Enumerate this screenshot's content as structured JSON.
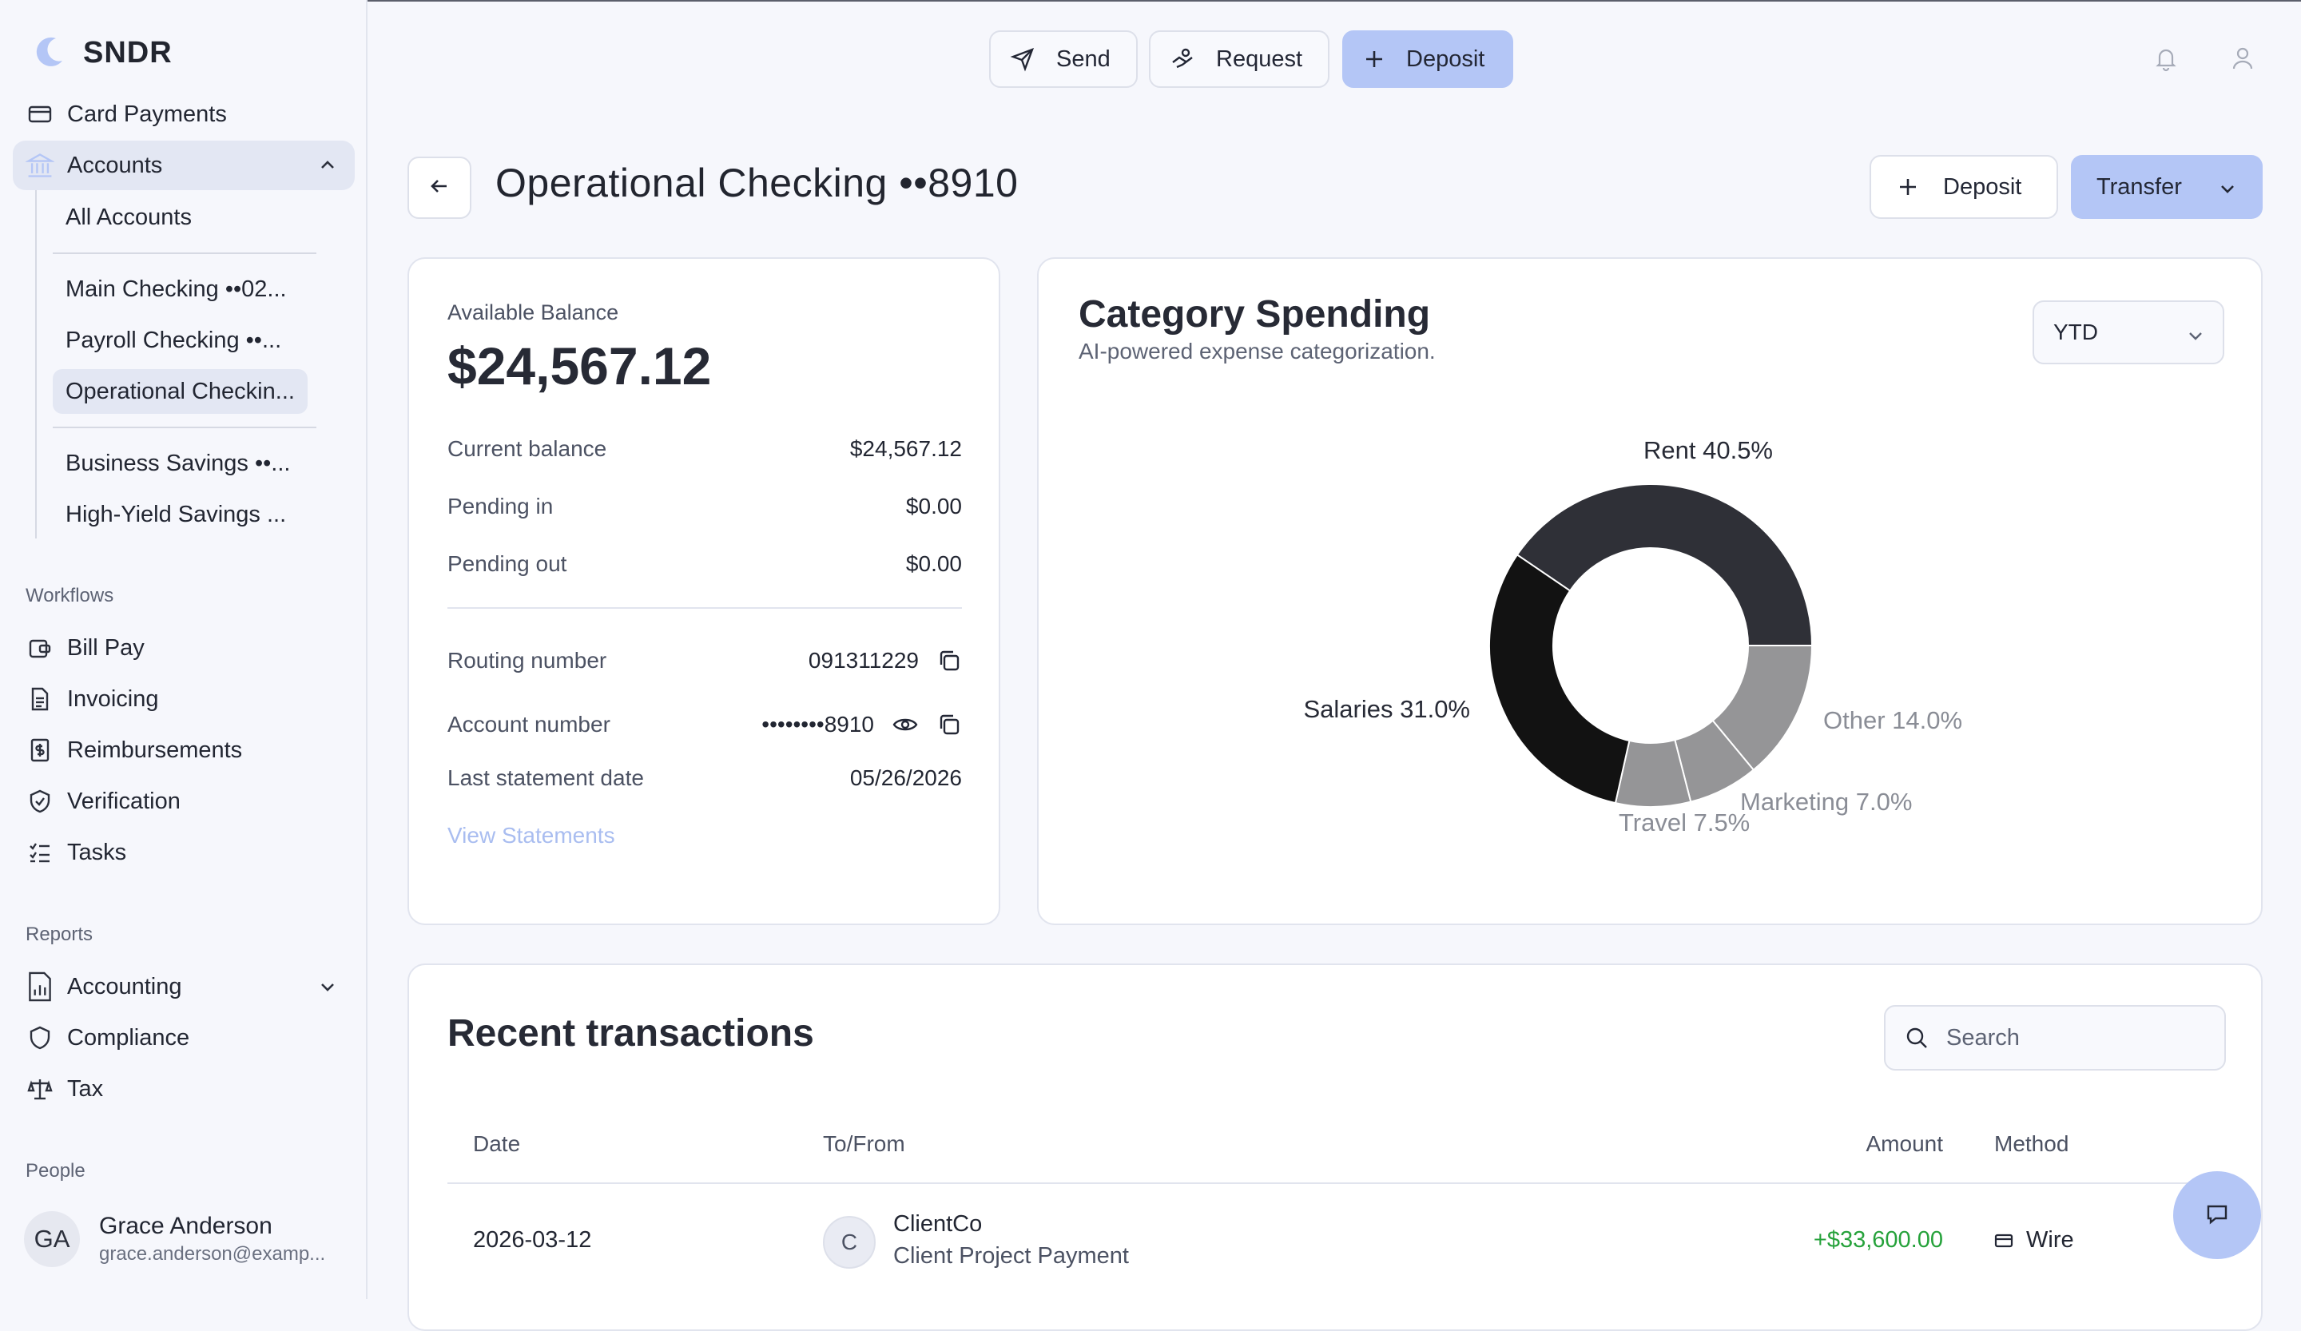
{
  "brand": {
    "name": "SNDR"
  },
  "sidebar": {
    "card_payments": "Card Payments",
    "accounts": "Accounts",
    "sub_items": [
      "All Accounts",
      "Main Checking ••02...",
      "Payroll Checking ••...",
      "Operational Checkin...",
      "Business Savings ••...",
      "High-Yield Savings ..."
    ],
    "workflows_label": "Workflows",
    "workflows": [
      "Bill Pay",
      "Invoicing",
      "Reimbursements",
      "Verification",
      "Tasks"
    ],
    "reports_label": "Reports",
    "reports": [
      "Accounting",
      "Compliance",
      "Tax"
    ],
    "people_label": "People",
    "user": {
      "initials": "GA",
      "name": "Grace Anderson",
      "email": "grace.anderson@examp..."
    }
  },
  "header": {
    "send": "Send",
    "request": "Request",
    "deposit": "Deposit"
  },
  "page": {
    "title": "Operational Checking ••8910",
    "deposit_label": "Deposit",
    "transfer_label": "Transfer"
  },
  "balance": {
    "label": "Available Balance",
    "amount": "$24,567.12",
    "rows": [
      {
        "label": "Current balance",
        "value": "$24,567.12"
      },
      {
        "label": "Pending in",
        "value": "$0.00"
      },
      {
        "label": "Pending out",
        "value": "$0.00"
      },
      {
        "label": "Routing number",
        "value": "091311229"
      },
      {
        "label": "Account number",
        "value": "••••••••8910"
      },
      {
        "label": "Last statement date",
        "value": "05/26/2026"
      }
    ],
    "view_statements": "View Statements"
  },
  "spending": {
    "title": "Category Spending",
    "subtitle": "AI-powered expense categorization.",
    "period": "YTD"
  },
  "chart_data": {
    "type": "pie",
    "categories": [
      "Rent",
      "Other",
      "Marketing",
      "Travel",
      "Salaries"
    ],
    "values": [
      40.5,
      14.0,
      7.0,
      7.5,
      31.0
    ],
    "labels": [
      "Rent 40.5%",
      "Other 14.0%",
      "Marketing 7.0%",
      "Travel 7.5%",
      "Salaries 31.0%"
    ],
    "colors": [
      "#2f3037",
      "#959597",
      "#959597",
      "#959597",
      "#121212"
    ],
    "donut": true
  },
  "transactions": {
    "title": "Recent transactions",
    "search_placeholder": "Search",
    "headers": {
      "date": "Date",
      "to_from": "To/From",
      "amount": "Amount",
      "method": "Method"
    },
    "rows": [
      {
        "date": "2026-03-12",
        "initial": "C",
        "name": "ClientCo",
        "description": "Client Project Payment",
        "amount": "+$33,600.00",
        "method": "Wire"
      }
    ]
  }
}
